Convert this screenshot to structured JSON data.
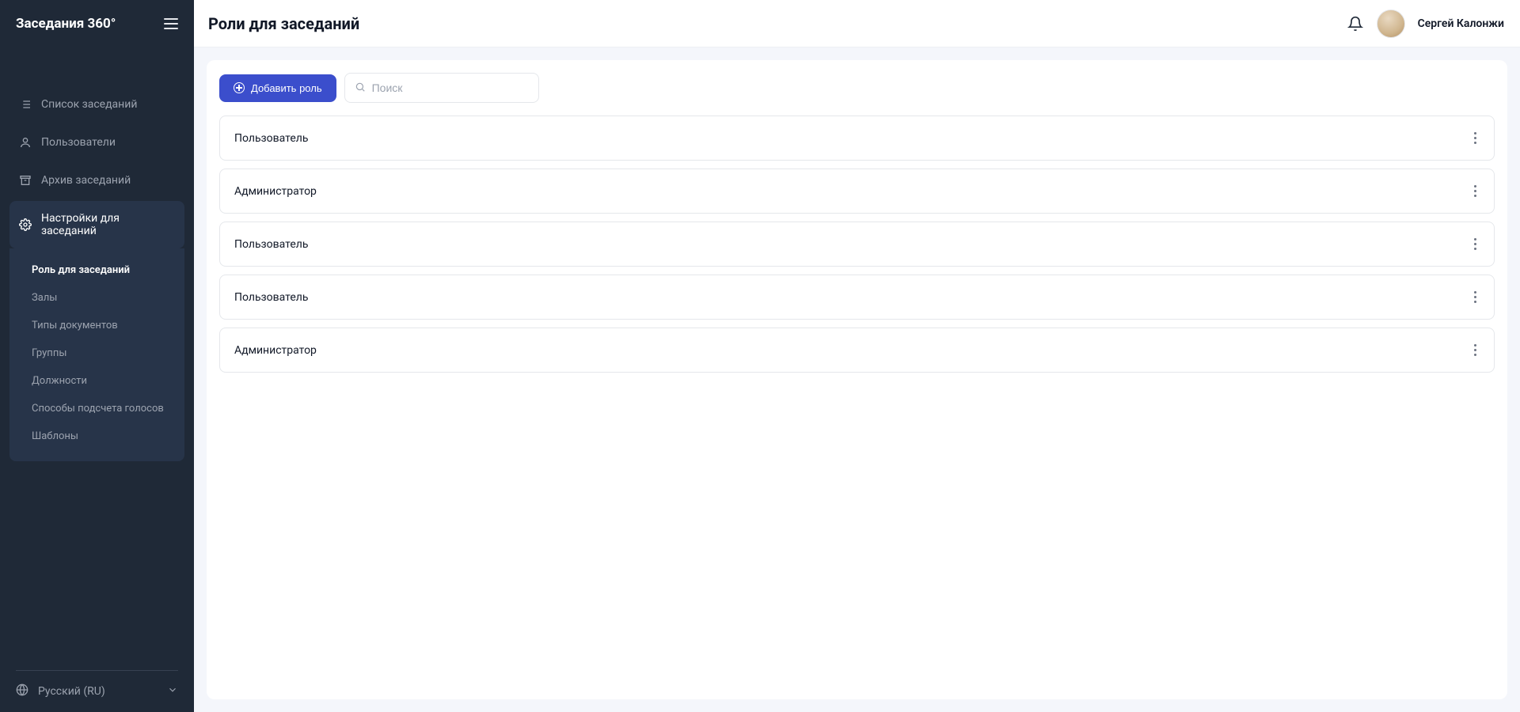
{
  "brand": "Заседания 360°",
  "header": {
    "title": "Роли для заседаний",
    "user_name": "Сергей Калонжи"
  },
  "sidebar": {
    "items": [
      {
        "icon": "list-icon",
        "label": "Список заседаний"
      },
      {
        "icon": "user-icon",
        "label": "Пользователи"
      },
      {
        "icon": "archive-icon",
        "label": "Архив заседаний"
      },
      {
        "icon": "gear-icon",
        "label": "Настройки для заседаний",
        "active": true
      }
    ],
    "subitems": [
      {
        "label": "Роль для заседаний",
        "active": true
      },
      {
        "label": "Залы"
      },
      {
        "label": "Типы документов"
      },
      {
        "label": "Группы"
      },
      {
        "label": "Должности"
      },
      {
        "label": "Способы подсчета голосов"
      },
      {
        "label": "Шаблоны"
      }
    ],
    "language": "Русский (RU)"
  },
  "toolbar": {
    "add_label": "Добавить роль",
    "search_placeholder": "Поиск",
    "search_value": ""
  },
  "roles": [
    {
      "name": "Пользователь"
    },
    {
      "name": "Администратор"
    },
    {
      "name": "Пользователь"
    },
    {
      "name": "Пользователь"
    },
    {
      "name": "Администратор"
    }
  ]
}
